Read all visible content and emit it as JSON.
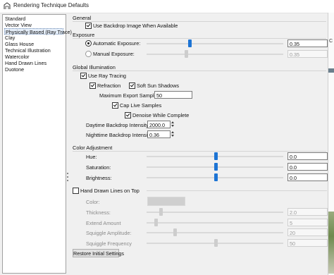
{
  "window": {
    "title": "Rendering Technique Defaults"
  },
  "techniques": [
    "Standard",
    "Vector View",
    "Physically Based (Ray Trace)",
    "Clay",
    "Glass House",
    "Technical Illustration",
    "Watercolor",
    "Hand Drawn Lines",
    "Duotone"
  ],
  "selected_technique": "Physically Based (Ray Trace)",
  "general": {
    "title": "General",
    "use_backdrop_label": "Use Backdrop Image When Available",
    "use_backdrop_checked": true
  },
  "exposure": {
    "title": "Exposure",
    "automatic_label": "Automatic Exposure:",
    "automatic_value": "0.35",
    "automatic_selected": true,
    "manual_label": "Manual Exposure:",
    "manual_value": "0.35"
  },
  "global_illumination": {
    "title": "Global Illumination",
    "use_ray_tracing_label": "Use Ray Tracing",
    "use_ray_tracing_checked": true,
    "refraction_label": "Refraction",
    "refraction_checked": true,
    "soft_sun_label": "Soft Sun Shadows",
    "soft_sun_checked": true,
    "max_samples_label": "Maximum Export Samples:",
    "max_samples_value": "50",
    "cap_samples_label": "Cap Live Samples",
    "cap_samples_checked": true,
    "denoise_label": "Denoise While Complete",
    "denoise_checked": true,
    "daytime_label": "Daytime Backdrop Intensity:",
    "daytime_value": "2000.0",
    "nighttime_label": "Nighttime Backdrop Intensity:",
    "nighttime_value": "0.36"
  },
  "color_adjustment": {
    "title": "Color Adjustment",
    "hue_label": "Hue:",
    "hue_value": "0.0",
    "saturation_label": "Saturation:",
    "saturation_value": "0.0",
    "brightness_label": "Brightness:",
    "brightness_value": "0.0"
  },
  "hand_drawn": {
    "title": "Hand Drawn Lines on Top",
    "checked": false,
    "color_label": "Color:",
    "thickness_label": "Thickness:",
    "thickness_value": "2.0",
    "extend_label": "Extend Amount",
    "extend_value": "5",
    "amplitude_label": "Squiggle Amplitude:",
    "amplitude_value": "20",
    "frequency_label": "Squiggle Frequency",
    "frequency_value": "50"
  },
  "restore_button": "Restore Initial Settings",
  "background_window": {
    "glyph": "C"
  },
  "colors": {
    "accent": "#1d74d4",
    "selection": "#e5eef9"
  },
  "icons": {
    "app": "chief-architect-house-icon"
  }
}
